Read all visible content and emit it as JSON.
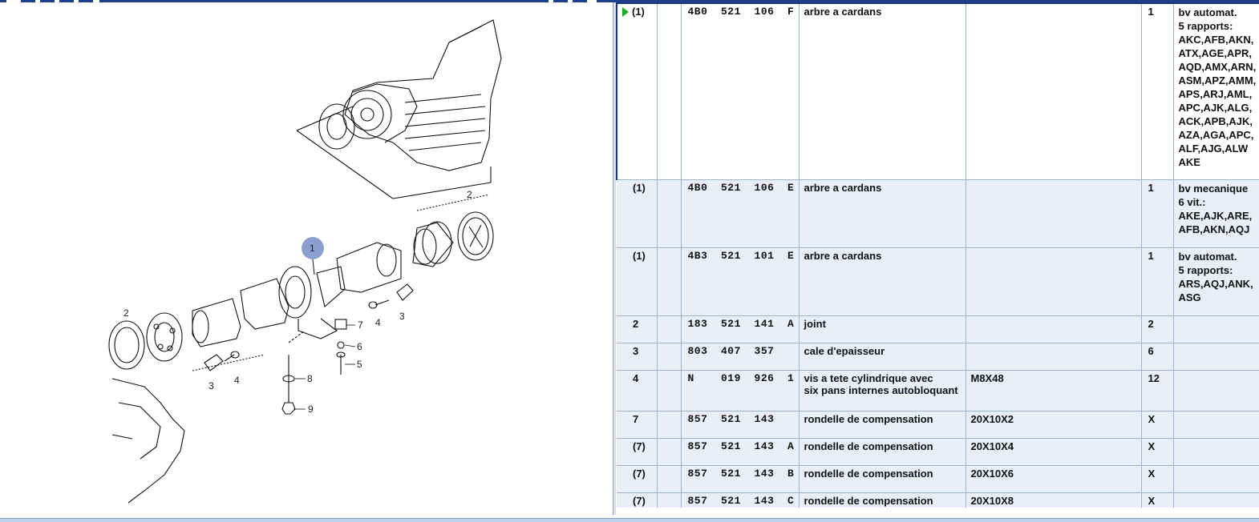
{
  "illustration": {
    "callouts": [
      "1",
      "2",
      "2",
      "3",
      "3",
      "4",
      "4",
      "5",
      "6",
      "7",
      "8",
      "9"
    ],
    "highlight_color": "#8a9fd0"
  },
  "parts": {
    "rows": [
      {
        "pos": "(1)",
        "part_no": "4B0  521  106  F",
        "description": "arbre a cardans",
        "size": "",
        "qty": "1",
        "note": "bv automat.\n5 rapports:\nAKC,AFB,AKN,\nATX,AGE,APR,\nAQD,AMX,ARN,\nASM,APZ,AMM,\nAPS,ARJ,AML,\nAPC,AJK,ALG,\nACK,APB,AJK,\nAZA,AGA,APC,\nALF,AJG,ALW\nAKE",
        "selected": true
      },
      {
        "pos": "(1)",
        "part_no": "4B0  521  106  E",
        "description": "arbre a cardans",
        "size": "",
        "qty": "1",
        "note": "bv mecanique\n6 vit.:\nAKE,AJK,ARE,\nAFB,AKN,AQJ"
      },
      {
        "pos": "(1)",
        "part_no": "4B3  521  101  E",
        "description": "arbre a cardans",
        "size": "",
        "qty": "1",
        "note": "bv automat.\n5 rapports:\nARS,AQJ,ANK,\nASG"
      },
      {
        "pos": "2",
        "part_no": "183  521  141  A",
        "description": "joint",
        "size": "",
        "qty": "2",
        "note": ""
      },
      {
        "pos": "3",
        "part_no": "803  407  357",
        "description": "cale d'epaisseur",
        "size": "",
        "qty": "6",
        "note": ""
      },
      {
        "pos": "4",
        "part_no": "N    019  926  1",
        "description": "vis a tete cylindrique avec\nsix pans internes autobloquant",
        "size": "M8X48",
        "qty": "12",
        "note": ""
      },
      {
        "pos": "7",
        "part_no": "857  521  143",
        "description": "rondelle de compensation",
        "size": "20X10X2",
        "qty": "X",
        "note": ""
      },
      {
        "pos": "(7)",
        "part_no": "857  521  143  A",
        "description": "rondelle de compensation",
        "size": "20X10X4",
        "qty": "X",
        "note": ""
      },
      {
        "pos": "(7)",
        "part_no": "857  521  143  B",
        "description": "rondelle de compensation",
        "size": "20X10X6",
        "qty": "X",
        "note": ""
      },
      {
        "pos": "(7)",
        "part_no": "857  521  143  C",
        "description": "rondelle de compensation",
        "size": "20X10X8",
        "qty": "X",
        "note": ""
      }
    ]
  },
  "colors": {
    "accent_navy": "#1e3f8a",
    "row_background": "#e9eef9",
    "grid_line": "#9fb3cf",
    "selection_marker": "#22aa22"
  }
}
